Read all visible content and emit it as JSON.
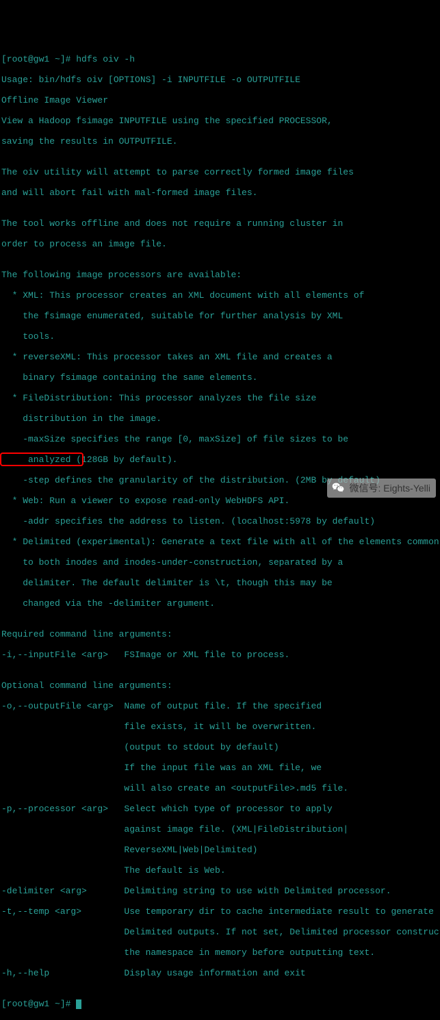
{
  "terminal": {
    "prompt1": "[root@gw1 ~]# hdfs oiv -h",
    "lines": [
      "Usage: bin/hdfs oiv [OPTIONS] -i INPUTFILE -o OUTPUTFILE",
      "Offline Image Viewer",
      "View a Hadoop fsimage INPUTFILE using the specified PROCESSOR,",
      "saving the results in OUTPUTFILE.",
      "",
      "The oiv utility will attempt to parse correctly formed image files",
      "and will abort fail with mal-formed image files.",
      "",
      "The tool works offline and does not require a running cluster in",
      "order to process an image file.",
      "",
      "The following image processors are available:",
      "  * XML: This processor creates an XML document with all elements of",
      "    the fsimage enumerated, suitable for further analysis by XML",
      "    tools.",
      "  * reverseXML: This processor takes an XML file and creates a",
      "    binary fsimage containing the same elements.",
      "  * FileDistribution: This processor analyzes the file size",
      "    distribution in the image.",
      "    -maxSize specifies the range [0, maxSize] of file sizes to be",
      "     analyzed (128GB by default).",
      "    -step defines the granularity of the distribution. (2MB by default)",
      "  * Web: Run a viewer to expose read-only WebHDFS API.",
      "    -addr specifies the address to listen. (localhost:5978 by default)",
      "  * Delimited (experimental): Generate a text file with all of the elements common",
      "    to both inodes and inodes-under-construction, separated by a",
      "    delimiter. The default delimiter is \\t, though this may be",
      "    changed via the -delimiter argument.",
      "",
      "Required command line arguments:",
      "-i,--inputFile <arg>   FSImage or XML file to process.",
      "",
      "Optional command line arguments:",
      "-o,--outputFile <arg>  Name of output file. If the specified",
      "                       file exists, it will be overwritten.",
      "                       (output to stdout by default)",
      "                       If the input file was an XML file, we",
      "                       will also create an <outputFile>.md5 file.",
      "-p,--processor <arg>   Select which type of processor to apply",
      "                       against image file. (XML|FileDistribution|",
      "                       ReverseXML|Web|Delimited)",
      "                       The default is Web.",
      "-delimiter <arg>       Delimiting string to use with Delimited processor.  ",
      "-t,--temp <arg>        Use temporary dir to cache intermediate result to generate",
      "                       Delimited outputs. If not set, Delimited processor constructs",
      "                       the namespace in memory before outputting text.",
      "-h,--help              Display usage information and exit",
      ""
    ],
    "prompt2": "[root@gw1 ~]# "
  },
  "watermark": {
    "text": "微信号: Eights-Yelli",
    "icon": "wechat-icon"
  },
  "highlight": {
    "target": "-t,--temp <arg>"
  }
}
